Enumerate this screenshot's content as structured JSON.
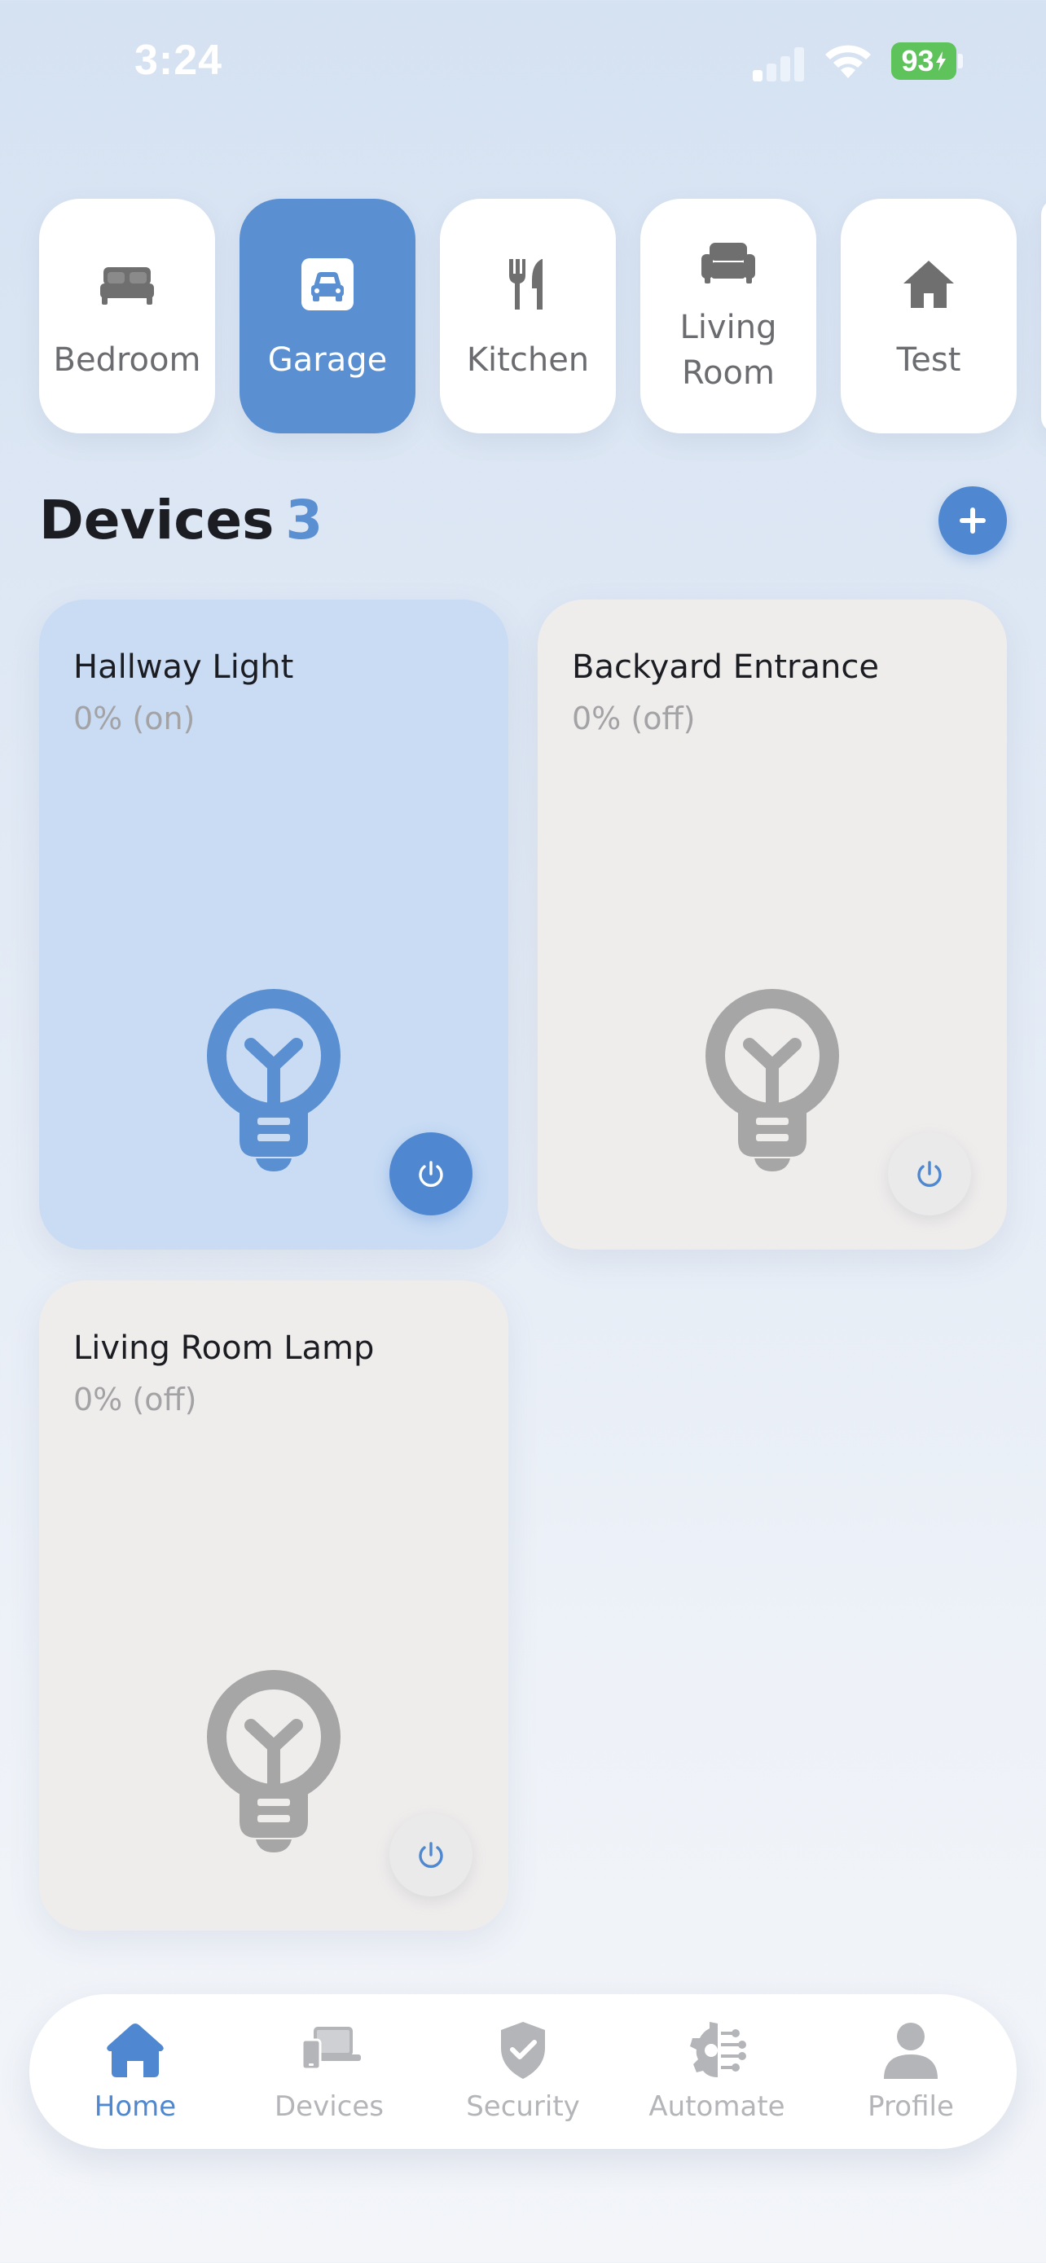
{
  "status_bar": {
    "time": "3:24",
    "battery": "93"
  },
  "rooms": [
    {
      "label": "Bedroom",
      "icon": "bed-icon",
      "active": false
    },
    {
      "label": "Garage",
      "icon": "car-icon",
      "active": true
    },
    {
      "label": "Kitchen",
      "icon": "fork-knife-icon",
      "active": false
    },
    {
      "label": "Living Room",
      "icon": "sofa-icon",
      "active": false
    },
    {
      "label": "Test",
      "icon": "house-icon",
      "active": false
    }
  ],
  "devices_header": {
    "title": "Devices",
    "count": "3"
  },
  "devices": [
    {
      "name": "Hallway Light",
      "status": "0% (on)",
      "on": true
    },
    {
      "name": "Backyard Entrance",
      "status": "0% (off)",
      "on": false
    },
    {
      "name": "Living Room Lamp",
      "status": "0% (off)",
      "on": false
    }
  ],
  "tabs": [
    {
      "label": "Home",
      "icon": "home-icon",
      "active": true
    },
    {
      "label": "Devices",
      "icon": "devices-icon",
      "active": false
    },
    {
      "label": "Security",
      "icon": "shield-check-icon",
      "active": false
    },
    {
      "label": "Automate",
      "icon": "gear-circuit-icon",
      "active": false
    },
    {
      "label": "Profile",
      "icon": "person-icon",
      "active": false
    }
  ],
  "colors": {
    "accent": "#4f88d0",
    "active_room": "#5a8fd2",
    "card_on": "#c9dcf4",
    "card_off": "#efedec",
    "bulb_on": "#5a8fd2",
    "bulb_off": "#a6a6a6",
    "battery": "#5ec35a"
  }
}
